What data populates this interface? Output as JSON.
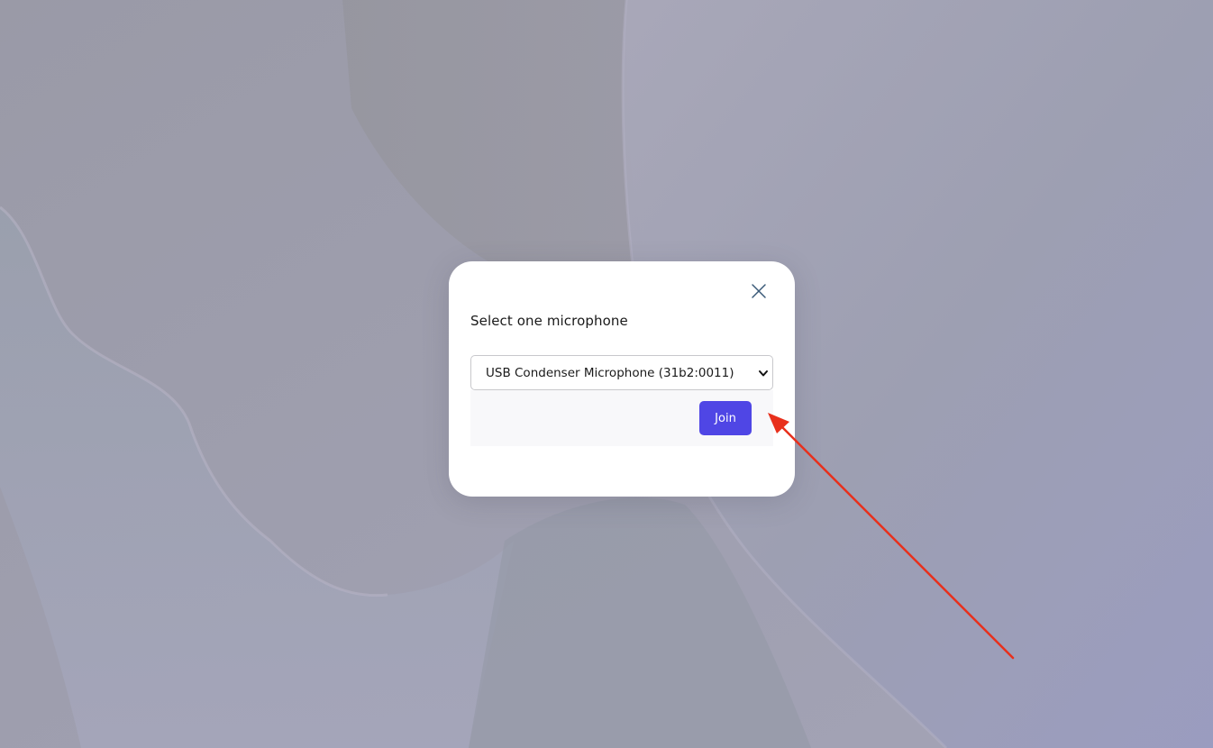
{
  "dialog": {
    "title": "Select one microphone",
    "microphone_select": {
      "selected": "USB Condenser Microphone (31b2:0011)"
    },
    "join_label": "Join",
    "close_icon": "close-icon"
  },
  "annotation": {
    "type": "arrow",
    "color": "#e8301c",
    "points_to": "join-button"
  },
  "colors": {
    "accent": "#4f46e5",
    "background": "#9c9cab"
  }
}
